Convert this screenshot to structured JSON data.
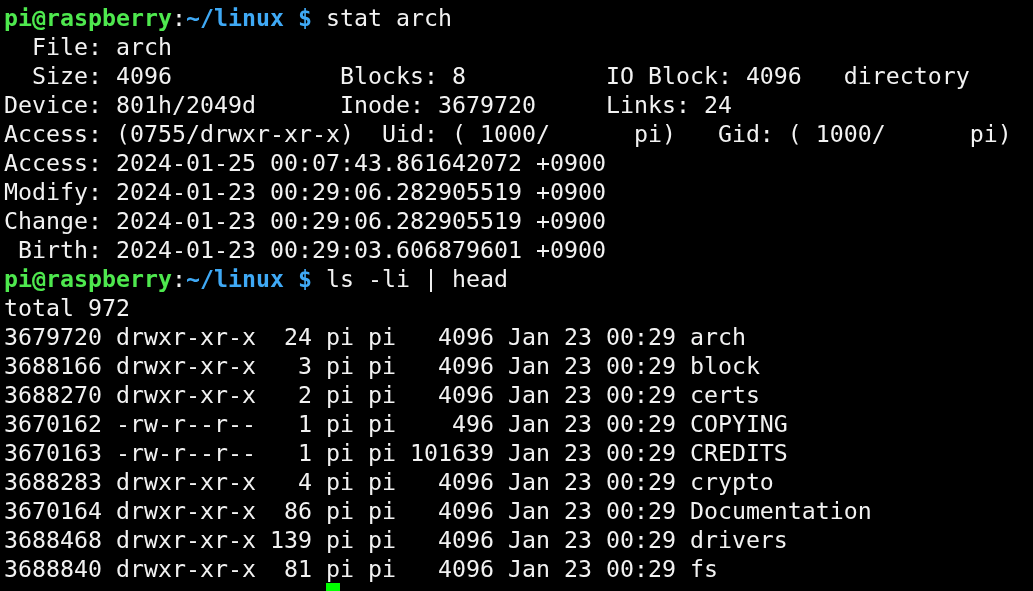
{
  "terminal": {
    "lines": [
      {
        "kind": "prompt",
        "user_host": "pi@raspberry",
        "separator": ":",
        "path": "~/linux",
        "symbol": "$",
        "command": "stat arch"
      },
      {
        "kind": "output",
        "text": "  File: arch"
      },
      {
        "kind": "output",
        "text": "  Size: 4096            Blocks: 8          IO Block: 4096   directory"
      },
      {
        "kind": "output",
        "text": "Device: 801h/2049d      Inode: 3679720     Links: 24"
      },
      {
        "kind": "output",
        "text": "Access: (0755/drwxr-xr-x)  Uid: ( 1000/      pi)   Gid: ( 1000/      pi)"
      },
      {
        "kind": "output",
        "text": "Access: 2024-01-25 00:07:43.861642072 +0900"
      },
      {
        "kind": "output",
        "text": "Modify: 2024-01-23 00:29:06.282905519 +0900"
      },
      {
        "kind": "output",
        "text": "Change: 2024-01-23 00:29:06.282905519 +0900"
      },
      {
        "kind": "output",
        "text": " Birth: 2024-01-23 00:29:03.606879601 +0900"
      },
      {
        "kind": "prompt",
        "user_host": "pi@raspberry",
        "separator": ":",
        "path": "~/linux",
        "symbol": "$",
        "command": "ls -li | head"
      },
      {
        "kind": "output",
        "text": "total 972"
      },
      {
        "kind": "output",
        "text": "3679720 drwxr-xr-x  24 pi pi   4096 Jan 23 00:29 arch"
      },
      {
        "kind": "output",
        "text": "3688166 drwxr-xr-x   3 pi pi   4096 Jan 23 00:29 block"
      },
      {
        "kind": "output",
        "text": "3688270 drwxr-xr-x   2 pi pi   4096 Jan 23 00:29 certs"
      },
      {
        "kind": "output",
        "text": "3670162 -rw-r--r--   1 pi pi    496 Jan 23 00:29 COPYING"
      },
      {
        "kind": "output",
        "text": "3670163 -rw-r--r--   1 pi pi 101639 Jan 23 00:29 CREDITS"
      },
      {
        "kind": "output",
        "text": "3688283 drwxr-xr-x   4 pi pi   4096 Jan 23 00:29 crypto"
      },
      {
        "kind": "output",
        "text": "3670164 drwxr-xr-x  86 pi pi   4096 Jan 23 00:29 Documentation"
      },
      {
        "kind": "output",
        "text": "3688468 drwxr-xr-x 139 pi pi   4096 Jan 23 00:29 drivers"
      },
      {
        "kind": "output",
        "text": "3688840 drwxr-xr-x  81 pi pi   4096 Jan 23 00:29 fs"
      },
      {
        "kind": "cursor"
      }
    ]
  }
}
